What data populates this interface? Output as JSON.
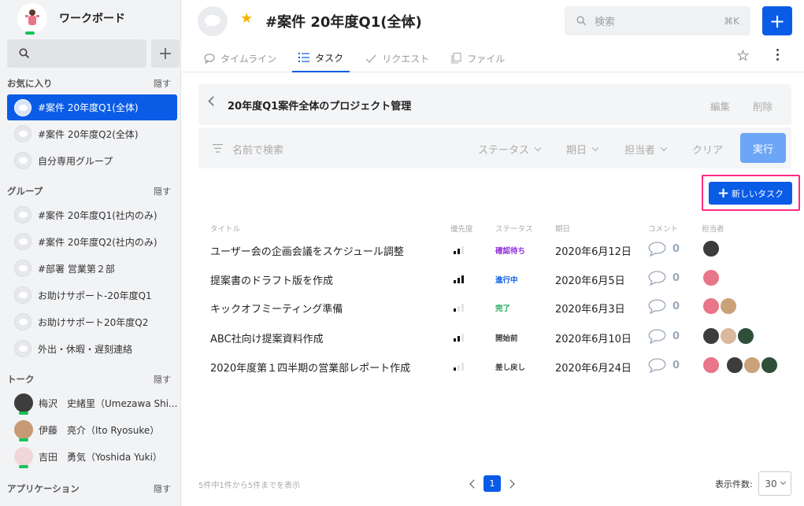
{
  "colors": {
    "accent": "#0a5ce6",
    "highlight_border": "#ff2b7f",
    "online": "#16c35b"
  },
  "sidebar": {
    "workspace_name": "ワークボード",
    "search_icon": "search-icon",
    "add_label": "+",
    "favorites": {
      "title": "お気に入り",
      "hide": "隠す",
      "items": [
        {
          "label": "#案件 20年度Q1(全体)",
          "active": true
        },
        {
          "label": "#案件 20年度Q2(全体)"
        },
        {
          "label": "自分専用グループ"
        }
      ]
    },
    "groups": {
      "title": "グループ",
      "hide": "隠す",
      "items": [
        {
          "label": "#案件 20年度Q1(社内のみ)"
        },
        {
          "label": "#案件 20年度Q2(社内のみ)"
        },
        {
          "label": "#部署 営業第２部"
        },
        {
          "label": "お助けサポート-20年度Q1"
        },
        {
          "label": "お助けサポート20年度Q2"
        },
        {
          "label": "外出・休暇・遅刻連絡"
        }
      ]
    },
    "talks": {
      "title": "トーク",
      "hide": "隠す",
      "items": [
        {
          "label": "梅沢　史緒里（Umezawa Shi..."
        },
        {
          "label": "伊藤　亮介（Ito Ryosuke）"
        },
        {
          "label": "吉田　勇気（Yoshida Yuki）"
        }
      ]
    },
    "apps": {
      "title": "アプリケーション",
      "hide": "隠す"
    }
  },
  "header": {
    "title": "#案件 20年度Q1(全体)",
    "search_placeholder": "検索",
    "search_shortcut": "⌘K",
    "plus_label": "+",
    "tabs": [
      {
        "label": "タイムライン",
        "icon": "chat-bubble-icon"
      },
      {
        "label": "タスク",
        "icon": "list-icon",
        "active": true
      },
      {
        "label": "リクエスト",
        "icon": "check-icon"
      },
      {
        "label": "ファイル",
        "icon": "file-icon"
      }
    ]
  },
  "project": {
    "title": "20年度Q1案件全体のプロジェクト管理",
    "edit": "編集",
    "delete": "削除"
  },
  "filter": {
    "name_placeholder": "名前で検索",
    "status": "ステータス",
    "date": "期日",
    "assignee": "担当者",
    "clear": "クリア",
    "run": "実行"
  },
  "new_task_label": "新しいタスク",
  "table": {
    "headers": {
      "title": "タイトル",
      "priority": "優先度",
      "status": "ステータス",
      "due": "期日",
      "comment": "コメント",
      "assignee": "担当者"
    },
    "rows": [
      {
        "title": "ユーザー会の企画会議をスケジュール調整",
        "priority": 2,
        "status": "確認待ち",
        "status_color": "#8e2fd8",
        "due": "2020年6月12日",
        "comments": "0",
        "assignees": [
          "#3c3c3c"
        ]
      },
      {
        "title": "提案書のドラフト版を作成",
        "priority": 3,
        "status": "進行中",
        "status_color": "#0a5ce6",
        "due": "2020年6月5日",
        "comments": "0",
        "assignees": [
          "#e8758a"
        ]
      },
      {
        "title": "キックオフミーティング準備",
        "priority": 1,
        "status": "完了",
        "status_color": "#1aa85a",
        "due": "2020年6月3日",
        "comments": "0",
        "assignees": [
          "#e8758a",
          "#c9a27a"
        ]
      },
      {
        "title": "ABC社向け提案資料作成",
        "priority": 2,
        "status": "開始前",
        "status_color": "#444444",
        "due": "2020年6月10日",
        "comments": "0",
        "assignees": [
          "#3c3c3c",
          "#d9b8a0",
          "#2f4f3a"
        ]
      },
      {
        "title": "2020年度第１四半期の営業部レポート作成",
        "priority": 1,
        "status": "差し戻し",
        "status_color": "#444444",
        "due": "2020年6月24日",
        "comments": "0",
        "assignees": [
          "#e8758a",
          "#3c3c3c",
          "#c9a27a",
          "#2f4f3a"
        ]
      }
    ]
  },
  "footer": {
    "summary": "5件中1件から5件までを表示",
    "page": "1",
    "per_page_label": "表示件数:",
    "per_page": "30"
  }
}
